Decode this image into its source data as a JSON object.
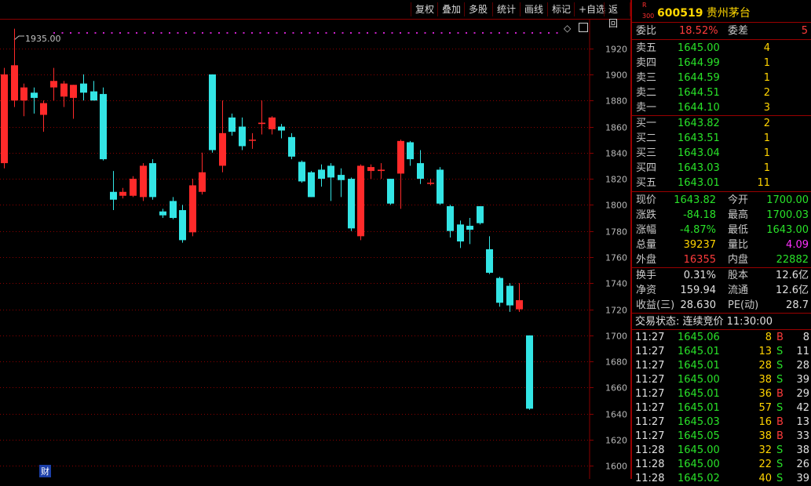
{
  "toolbar": {
    "buttons": [
      "复权",
      "叠加",
      "多股",
      "统计",
      "画线",
      "标记",
      "+自选",
      "返回"
    ]
  },
  "chart": {
    "top_price_label": "1935.00",
    "y_ticks": [
      "1920",
      "1900",
      "1880",
      "1860",
      "1840",
      "1820",
      "1800",
      "1780",
      "1760",
      "1740",
      "1720",
      "1700",
      "1680",
      "1660",
      "1640",
      "1620",
      "1600"
    ],
    "finance_badge": "财",
    "colors": {
      "up": "#ff2a2a",
      "down": "#33e5e5",
      "grid": "#8a0000",
      "dots": "#cc22cc"
    }
  },
  "chart_data": {
    "type": "candlestick",
    "ylim": [
      1590,
      1942
    ],
    "y_ticks": [
      1600,
      1620,
      1640,
      1660,
      1680,
      1700,
      1720,
      1740,
      1760,
      1780,
      1800,
      1820,
      1840,
      1860,
      1880,
      1900,
      1920
    ],
    "candles": [
      {
        "o": 1832,
        "h": 1905,
        "l": 1828,
        "c": 1900
      },
      {
        "o": 1880,
        "h": 1935,
        "l": 1875,
        "c": 1907
      },
      {
        "o": 1880,
        "h": 1893,
        "l": 1868,
        "c": 1890
      },
      {
        "o": 1886,
        "h": 1890,
        "l": 1870,
        "c": 1882
      },
      {
        "o": 1869,
        "h": 1880,
        "l": 1856,
        "c": 1878
      },
      {
        "o": 1890,
        "h": 1905,
        "l": 1880,
        "c": 1895
      },
      {
        "o": 1883,
        "h": 1895,
        "l": 1875,
        "c": 1893
      },
      {
        "o": 1882,
        "h": 1892,
        "l": 1866,
        "c": 1892
      },
      {
        "o": 1893,
        "h": 1900,
        "l": 1880,
        "c": 1886
      },
      {
        "o": 1887,
        "h": 1895,
        "l": 1880,
        "c": 1880
      },
      {
        "o": 1885,
        "h": 1890,
        "l": 1834,
        "c": 1835
      },
      {
        "o": 1810,
        "h": 1826,
        "l": 1796,
        "c": 1804
      },
      {
        "o": 1807,
        "h": 1813,
        "l": 1805,
        "c": 1810
      },
      {
        "o": 1807,
        "h": 1822,
        "l": 1806,
        "c": 1820
      },
      {
        "o": 1806,
        "h": 1832,
        "l": 1803,
        "c": 1830
      },
      {
        "o": 1832,
        "h": 1835,
        "l": 1804,
        "c": 1806
      },
      {
        "o": 1795,
        "h": 1797,
        "l": 1790,
        "c": 1792
      },
      {
        "o": 1803,
        "h": 1806,
        "l": 1789,
        "c": 1790
      },
      {
        "o": 1796,
        "h": 1800,
        "l": 1771,
        "c": 1773
      },
      {
        "o": 1779,
        "h": 1820,
        "l": 1776,
        "c": 1815
      },
      {
        "o": 1810,
        "h": 1840,
        "l": 1808,
        "c": 1825
      },
      {
        "o": 1900,
        "h": 1900,
        "l": 1840,
        "c": 1842
      },
      {
        "o": 1830,
        "h": 1880,
        "l": 1825,
        "c": 1855
      },
      {
        "o": 1867,
        "h": 1870,
        "l": 1853,
        "c": 1856
      },
      {
        "o": 1860,
        "h": 1867,
        "l": 1842,
        "c": 1845
      },
      {
        "o": 1850,
        "h": 1855,
        "l": 1843,
        "c": 1850
      },
      {
        "o": 1862,
        "h": 1880,
        "l": 1854,
        "c": 1863
      },
      {
        "o": 1858,
        "h": 1868,
        "l": 1854,
        "c": 1867
      },
      {
        "o": 1860,
        "h": 1862,
        "l": 1851,
        "c": 1857
      },
      {
        "o": 1852,
        "h": 1855,
        "l": 1835,
        "c": 1837
      },
      {
        "o": 1833,
        "h": 1834,
        "l": 1817,
        "c": 1818
      },
      {
        "o": 1825,
        "h": 1826,
        "l": 1806,
        "c": 1806
      },
      {
        "o": 1827,
        "h": 1831,
        "l": 1814,
        "c": 1820
      },
      {
        "o": 1830,
        "h": 1832,
        "l": 1803,
        "c": 1821
      },
      {
        "o": 1823,
        "h": 1828,
        "l": 1806,
        "c": 1819
      },
      {
        "o": 1820,
        "h": 1821,
        "l": 1780,
        "c": 1782
      },
      {
        "o": 1776,
        "h": 1831,
        "l": 1773,
        "c": 1830
      },
      {
        "o": 1826,
        "h": 1831,
        "l": 1820,
        "c": 1829
      },
      {
        "o": 1826,
        "h": 1832,
        "l": 1820,
        "c": 1827
      },
      {
        "o": 1820,
        "h": 1820,
        "l": 1800,
        "c": 1801
      },
      {
        "o": 1824,
        "h": 1850,
        "l": 1797,
        "c": 1849
      },
      {
        "o": 1848,
        "h": 1849,
        "l": 1830,
        "c": 1835
      },
      {
        "o": 1832,
        "h": 1842,
        "l": 1816,
        "c": 1820
      },
      {
        "o": 1817,
        "h": 1820,
        "l": 1815,
        "c": 1817
      },
      {
        "o": 1827,
        "h": 1829,
        "l": 1800,
        "c": 1801
      },
      {
        "o": 1799,
        "h": 1800,
        "l": 1775,
        "c": 1780
      },
      {
        "o": 1785,
        "h": 1788,
        "l": 1767,
        "c": 1772
      },
      {
        "o": 1784,
        "h": 1790,
        "l": 1770,
        "c": 1781
      },
      {
        "o": 1799,
        "h": 1799,
        "l": 1785,
        "c": 1786
      },
      {
        "o": 1766,
        "h": 1776,
        "l": 1747,
        "c": 1748
      },
      {
        "o": 1744,
        "h": 1745,
        "l": 1722,
        "c": 1725
      },
      {
        "o": 1738,
        "h": 1740,
        "l": 1718,
        "c": 1723
      },
      {
        "o": 1720,
        "h": 1740,
        "l": 1718,
        "c": 1727
      },
      {
        "o": 1700,
        "h": 1700,
        "l": 1643,
        "c": 1643.82
      }
    ]
  },
  "panel": {
    "badge_r": "R",
    "badge_n": "300",
    "code": "600519",
    "name": "贵州茅台",
    "weibi_label": "委比",
    "weibi_value": "18.52%",
    "weicha_label": "委差",
    "weicha_value": "5",
    "asks": [
      {
        "label": "卖五",
        "price": "1645.00",
        "vol": "4"
      },
      {
        "label": "卖四",
        "price": "1644.99",
        "vol": "1"
      },
      {
        "label": "卖三",
        "price": "1644.59",
        "vol": "1"
      },
      {
        "label": "卖二",
        "price": "1644.51",
        "vol": "2"
      },
      {
        "label": "卖一",
        "price": "1644.10",
        "vol": "3"
      }
    ],
    "bids": [
      {
        "label": "买一",
        "price": "1643.82",
        "vol": "2"
      },
      {
        "label": "买二",
        "price": "1643.51",
        "vol": "1"
      },
      {
        "label": "买三",
        "price": "1643.04",
        "vol": "1"
      },
      {
        "label": "买四",
        "price": "1643.03",
        "vol": "1"
      },
      {
        "label": "买五",
        "price": "1643.01",
        "vol": "11"
      }
    ],
    "stats1": [
      {
        "l1": "现价",
        "v1": "1643.82",
        "c1": "grn",
        "l2": "今开",
        "v2": "1700.00",
        "c2": "grn"
      },
      {
        "l1": "涨跌",
        "v1": "-84.18",
        "c1": "grn",
        "l2": "最高",
        "v2": "1700.03",
        "c2": "grn"
      },
      {
        "l1": "涨幅",
        "v1": "-4.87%",
        "c1": "grn",
        "l2": "最低",
        "v2": "1643.00",
        "c2": "grn"
      },
      {
        "l1": "总量",
        "v1": "39237",
        "c1": "yel",
        "l2": "量比",
        "v2": "4.09",
        "c2": "mag"
      },
      {
        "l1": "外盘",
        "v1": "16355",
        "c1": "red",
        "l2": "内盘",
        "v2": "22882",
        "c2": "grn"
      }
    ],
    "stats2": [
      {
        "l1": "换手",
        "v1": "0.31%",
        "l2": "股本",
        "v2": "12.6亿"
      },
      {
        "l1": "净资",
        "v1": "159.94",
        "l2": "流通",
        "v2": "12.6亿"
      },
      {
        "l1": "收益(三)",
        "v1": "28.630",
        "l2": "PE(动)",
        "v2": "28.7"
      }
    ],
    "trade_status": "交易状态: 连续竞价 11:30:00",
    "ticks": [
      {
        "time": "11:27",
        "price": "1645.06",
        "vol": "8",
        "bs": "B",
        "n": "8"
      },
      {
        "time": "11:27",
        "price": "1645.01",
        "vol": "13",
        "bs": "S",
        "n": "11"
      },
      {
        "time": "11:27",
        "price": "1645.01",
        "vol": "28",
        "bs": "S",
        "n": "28"
      },
      {
        "time": "11:27",
        "price": "1645.00",
        "vol": "38",
        "bs": "S",
        "n": "39"
      },
      {
        "time": "11:27",
        "price": "1645.01",
        "vol": "36",
        "bs": "B",
        "n": "29"
      },
      {
        "time": "11:27",
        "price": "1645.01",
        "vol": "57",
        "bs": "S",
        "n": "42"
      },
      {
        "time": "11:27",
        "price": "1645.03",
        "vol": "16",
        "bs": "B",
        "n": "13"
      },
      {
        "time": "11:27",
        "price": "1645.05",
        "vol": "38",
        "bs": "B",
        "n": "33"
      },
      {
        "time": "11:28",
        "price": "1645.00",
        "vol": "32",
        "bs": "S",
        "n": "38"
      },
      {
        "time": "11:28",
        "price": "1645.00",
        "vol": "22",
        "bs": "S",
        "n": "26"
      },
      {
        "time": "11:28",
        "price": "1645.02",
        "vol": "40",
        "bs": "S",
        "n": "39"
      }
    ]
  }
}
